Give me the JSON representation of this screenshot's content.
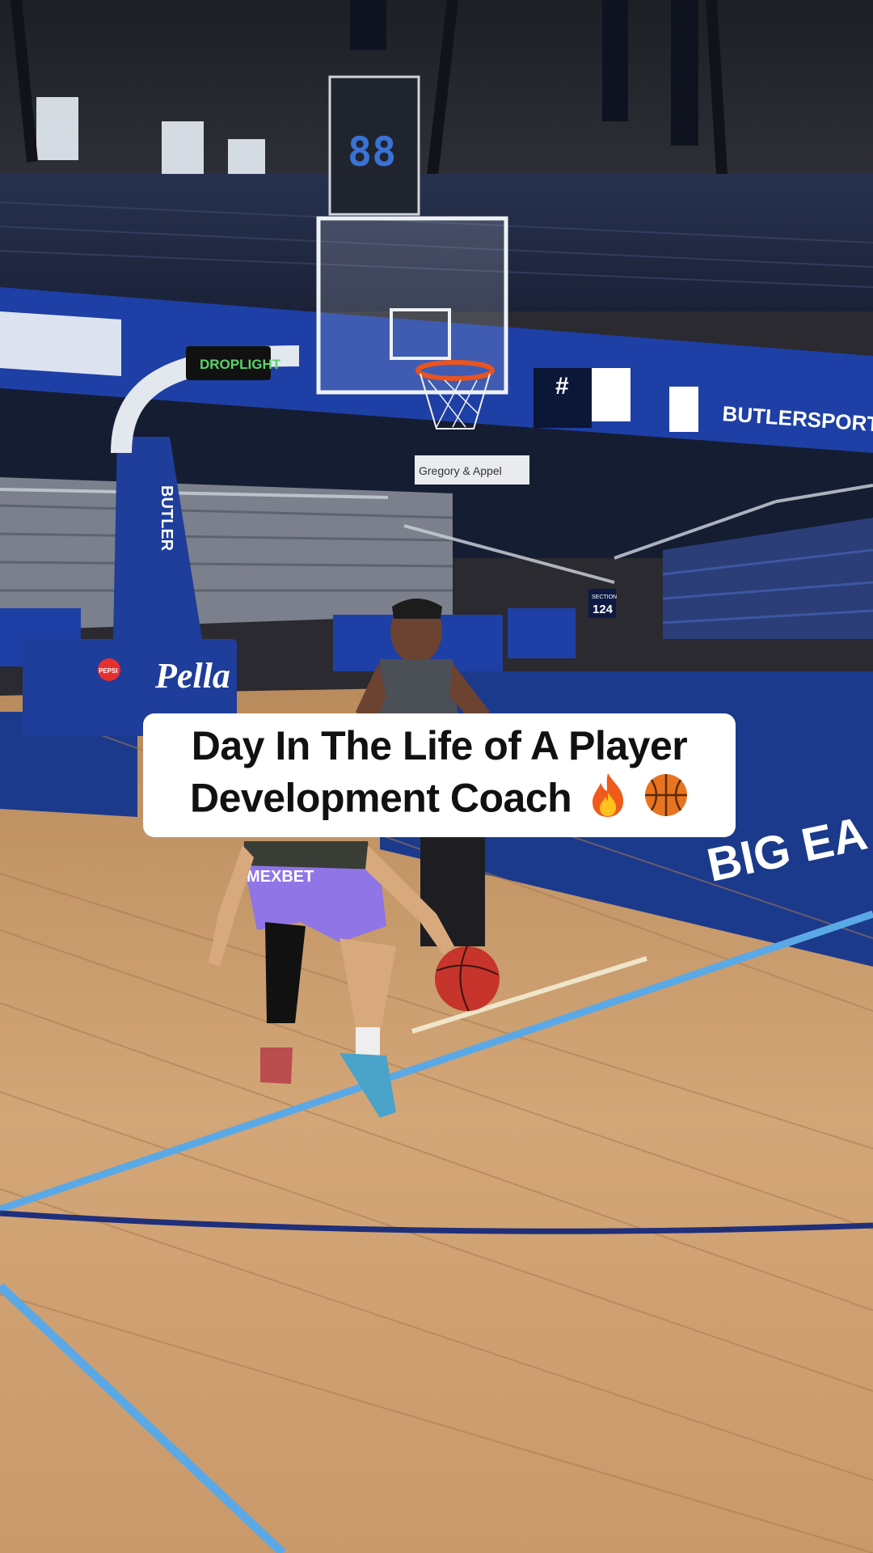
{
  "caption": {
    "line1": "Day In The Life of A Player",
    "line2": "Development Coach",
    "emojis": [
      "fire-icon",
      "basketball-icon"
    ]
  },
  "venue_signage": {
    "hoop_display": "DROPLIGHT",
    "sponsor_pella": "Pella",
    "sponsor_pepsi": "PEPSI",
    "stanchion_text": "BUTLER",
    "board_url": "BUTLERSPORTS.COM/BUYTIC",
    "section_label": "SECTION",
    "section_number": "124",
    "banner_sign": "Gregory & Appel",
    "scoreboard_hash": "#",
    "floor_logo": "BIG EA",
    "shorts_text": "MEXBET",
    "scoreboard_digits": "88"
  },
  "colors": {
    "court_wood": "#c99a67",
    "court_blue": "#1c3a8c",
    "line_light_blue": "#5aa9e6",
    "arena_navy": "#13245c"
  }
}
